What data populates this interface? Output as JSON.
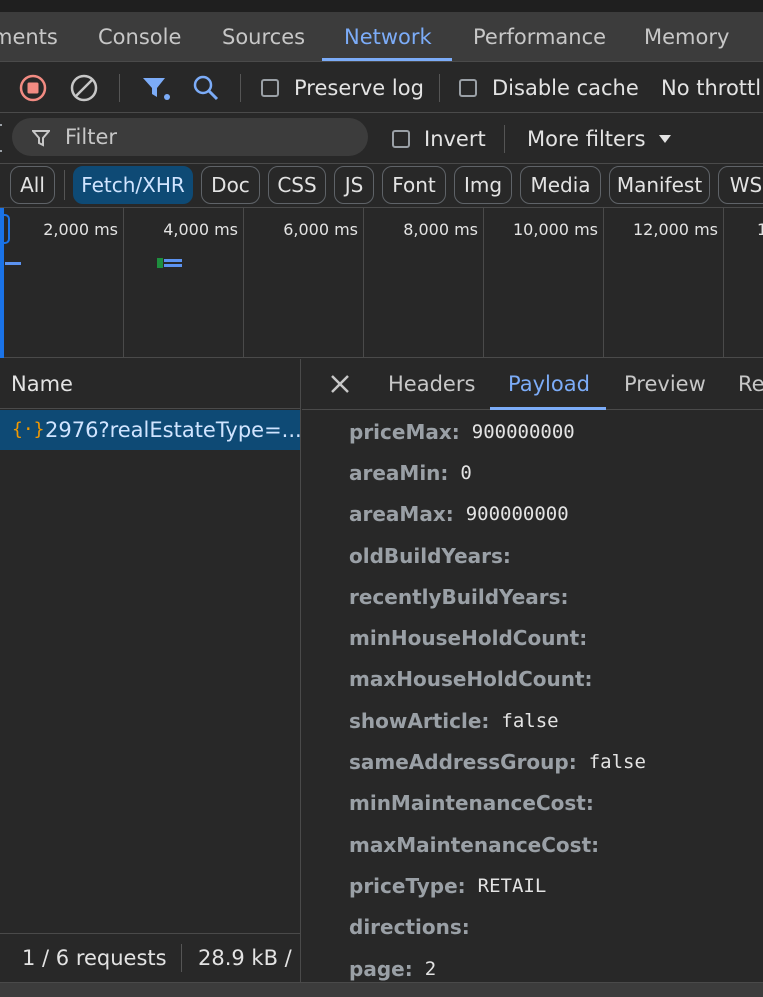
{
  "devtools_tabs": [
    {
      "label": "ments"
    },
    {
      "label": "Console"
    },
    {
      "label": "Sources"
    },
    {
      "label": "Network"
    },
    {
      "label": "Performance"
    },
    {
      "label": "Memory"
    }
  ],
  "active_tab": "Network",
  "toolbar": {
    "preserve_log_label": "Preserve log",
    "disable_cache_label": "Disable cache",
    "throttling_label": "No throttl",
    "record_color": "#f28b82",
    "accent_color": "#7cacf8"
  },
  "filterbar": {
    "filter_placeholder": "Filter",
    "invert_label": "Invert",
    "more_filters_label": "More filters"
  },
  "type_filters": [
    {
      "label": "All",
      "active": false
    },
    {
      "label": "Fetch/XHR",
      "active": true
    },
    {
      "label": "Doc",
      "active": false
    },
    {
      "label": "CSS",
      "active": false
    },
    {
      "label": "JS",
      "active": false
    },
    {
      "label": "Font",
      "active": false
    },
    {
      "label": "Img",
      "active": false
    },
    {
      "label": "Media",
      "active": false
    },
    {
      "label": "Manifest",
      "active": false
    },
    {
      "label": "WS",
      "active": false
    }
  ],
  "timeline": {
    "labels": [
      "2,000 ms",
      "4,000 ms",
      "6,000 ms",
      "8,000 ms",
      "10,000 ms",
      "12,000 ms",
      "1"
    ]
  },
  "requests": {
    "column_name": "Name",
    "items": [
      {
        "name": "2976?realEstateType=...",
        "icon": "fetch-icon",
        "selected": true
      }
    ]
  },
  "status": {
    "requests_text": "1 / 6 requests",
    "transferred_text": "28.9 kB / ."
  },
  "detail_tabs": [
    {
      "label": "Headers"
    },
    {
      "label": "Payload"
    },
    {
      "label": "Preview"
    },
    {
      "label": "Re"
    }
  ],
  "active_detail_tab": "Payload",
  "payload": [
    {
      "key": "priceMax:",
      "value": "900000000"
    },
    {
      "key": "areaMin:",
      "value": "0"
    },
    {
      "key": "areaMax:",
      "value": "900000000"
    },
    {
      "key": "oldBuildYears:",
      "value": ""
    },
    {
      "key": "recentlyBuildYears:",
      "value": ""
    },
    {
      "key": "minHouseHoldCount:",
      "value": ""
    },
    {
      "key": "maxHouseHoldCount:",
      "value": ""
    },
    {
      "key": "showArticle:",
      "value": "false"
    },
    {
      "key": "sameAddressGroup:",
      "value": "false"
    },
    {
      "key": "minMaintenanceCost:",
      "value": ""
    },
    {
      "key": "maxMaintenanceCost:",
      "value": ""
    },
    {
      "key": "priceType:",
      "value": "RETAIL"
    },
    {
      "key": "directions:",
      "value": ""
    },
    {
      "key": "page:",
      "value": "2"
    }
  ]
}
